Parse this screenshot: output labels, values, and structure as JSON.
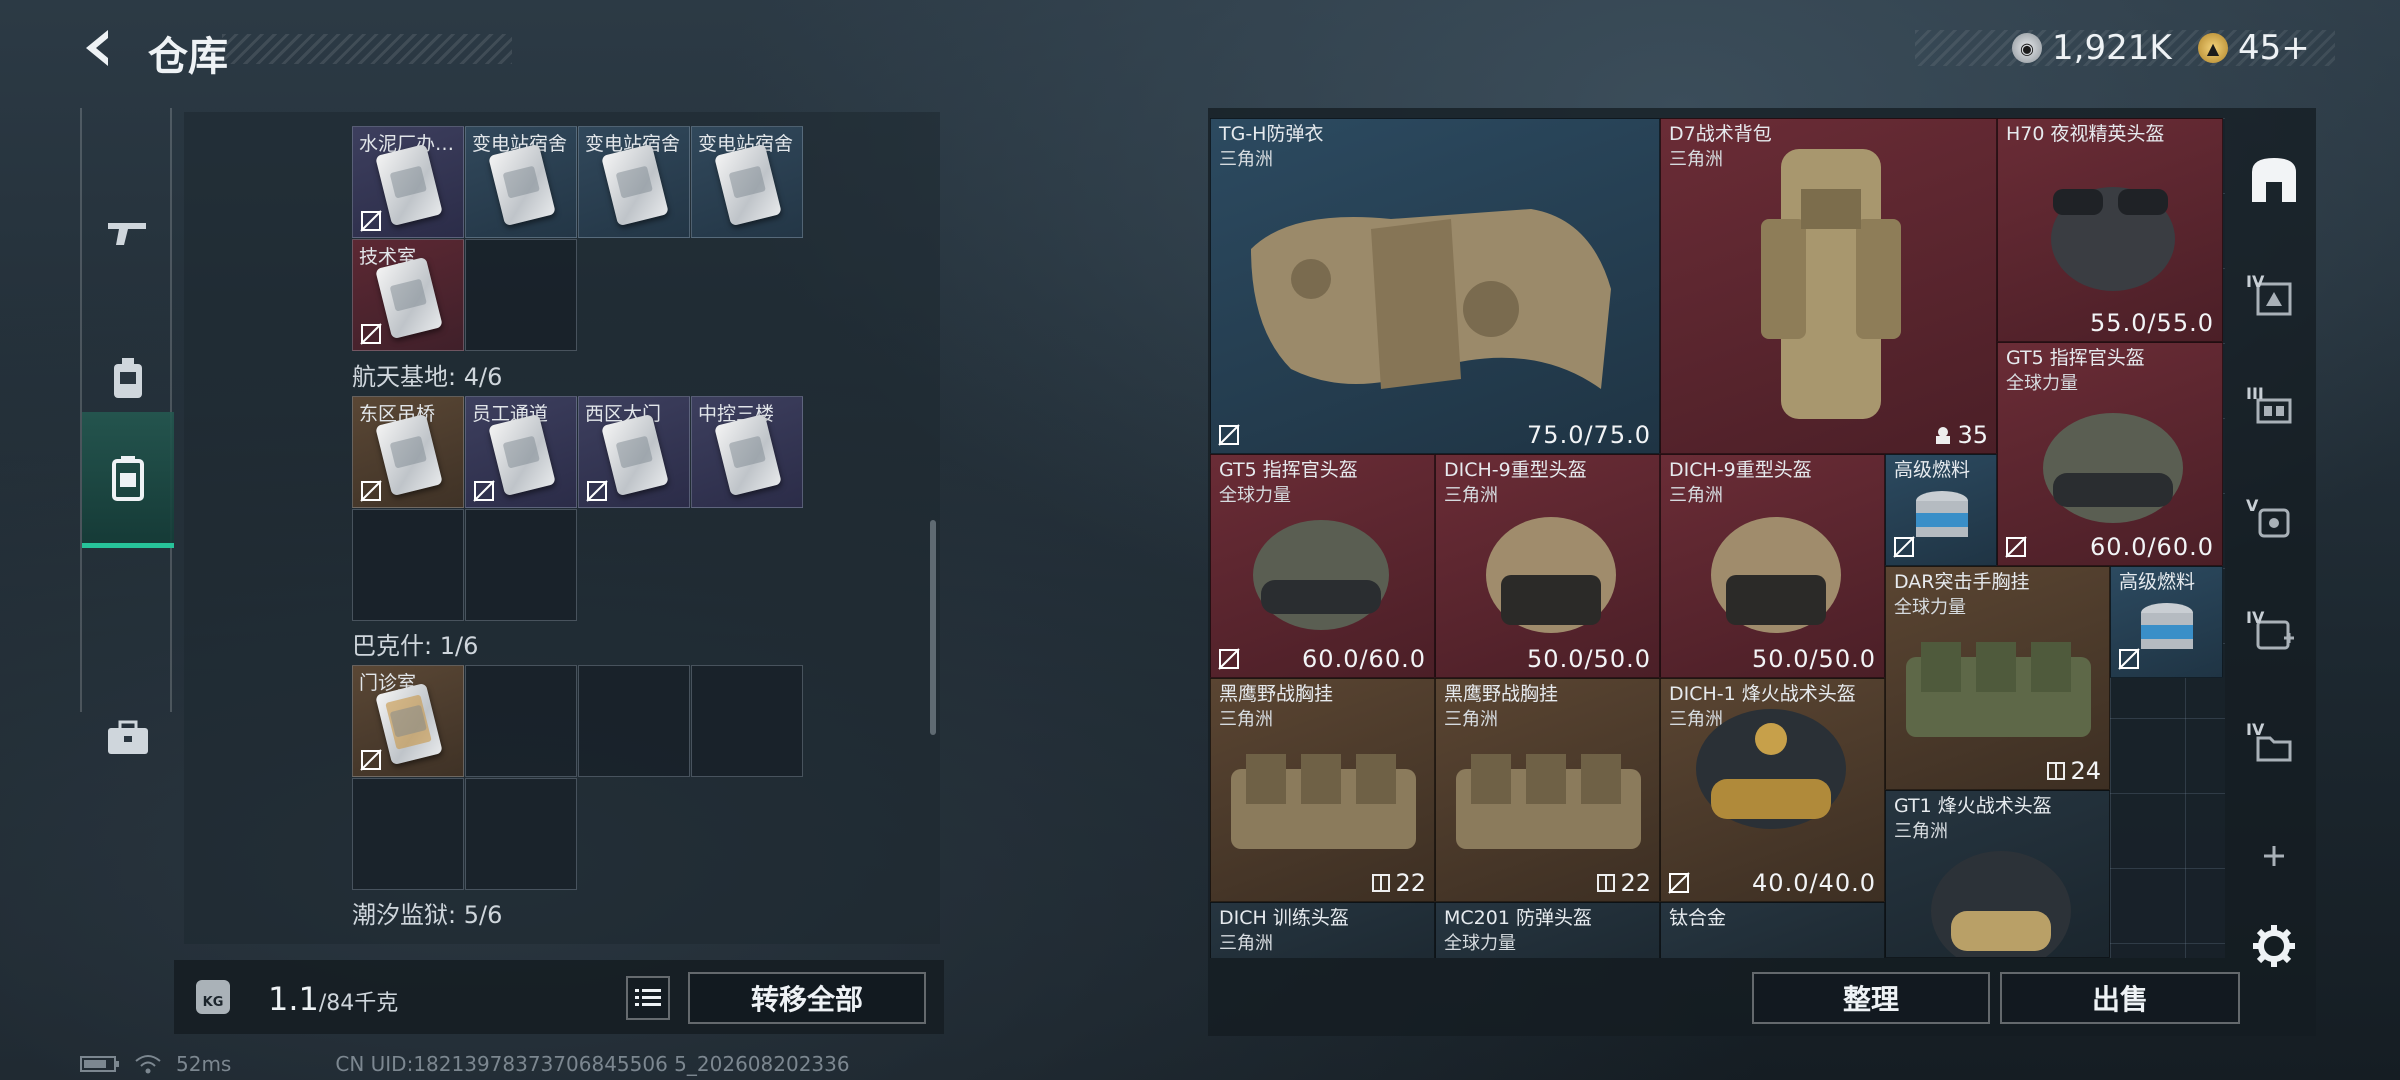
{
  "header": {
    "title": "仓库",
    "currency_silver": "1,921K",
    "currency_gold": "45+"
  },
  "rail": {
    "items": [
      {
        "name": "weapons-icon"
      },
      {
        "name": "gear-icon"
      },
      {
        "name": "keycard-icon"
      },
      {
        "name": "case-icon"
      }
    ]
  },
  "storage": {
    "top_row": [
      "水泥厂办…",
      "变电站宿舍",
      "变电站宿舍",
      "变电站宿舍"
    ],
    "extra_row": [
      "技术室"
    ],
    "section_aerospace": "航天基地: 4/6",
    "aerospace_row": [
      "东区吊桥",
      "员工通道",
      "西区大门",
      "中控三楼"
    ],
    "section_bakesh": "巴克什: 1/6",
    "bakesh_row": [
      "门诊室"
    ],
    "section_tide": "潮汐监狱: 5/6"
  },
  "weight": {
    "current": "1.1",
    "max": "/84千克",
    "transfer_all": "转移全部"
  },
  "inventory": {
    "items": [
      {
        "name": "TG-H防弹衣",
        "sub": "三角洲",
        "value": "75.0/75.0"
      },
      {
        "name": "D7战术背包",
        "sub": "三角洲",
        "count": "35"
      },
      {
        "name": "H70 夜视精英头盔",
        "sub": "",
        "value": "55.0/55.0"
      },
      {
        "name": "GT5 指挥官头盔",
        "sub": "全球力量",
        "value": "60.0/60.0"
      },
      {
        "name": "GT5 指挥官头盔",
        "sub": "全球力量",
        "value": "60.0/60.0"
      },
      {
        "name": "DICH-9重型头盔",
        "sub": "三角洲",
        "value": "50.0/50.0"
      },
      {
        "name": "DICH-9重型头盔",
        "sub": "三角洲",
        "value": "50.0/50.0"
      },
      {
        "name": "高级燃料",
        "sub": ""
      },
      {
        "name": "DAR突击手胸挂",
        "sub": "全球力量",
        "count": "24"
      },
      {
        "name": "高级燃料",
        "sub": ""
      },
      {
        "name": "黑鹰野战胸挂",
        "sub": "三角洲",
        "count": "22"
      },
      {
        "name": "黑鹰野战胸挂",
        "sub": "三角洲",
        "count": "22"
      },
      {
        "name": "DICH-1 烽火战术头盔",
        "sub": "三角洲",
        "value": "40.0/40.0"
      },
      {
        "name": "GT1 烽火战术头盔",
        "sub": "三角洲"
      },
      {
        "name": "DICH 训练头盔",
        "sub": "三角洲"
      },
      {
        "name": "MC201 防弹头盔",
        "sub": "全球力量"
      },
      {
        "name": "钛合金",
        "sub": ""
      }
    ],
    "sort_button": "整理",
    "sell_button": "出售"
  },
  "side_rail": {
    "tiers": [
      "IV",
      "III",
      "V",
      "IV",
      "IV"
    ]
  },
  "footer": {
    "ping": "52ms",
    "uid": "CN UID:18213978373706845506 5_202608202336"
  },
  "colors": {
    "accent": "#27c39a",
    "item_red": "#6a2c36",
    "item_blue": "#2c4a60",
    "item_brown": "#5a4532"
  }
}
